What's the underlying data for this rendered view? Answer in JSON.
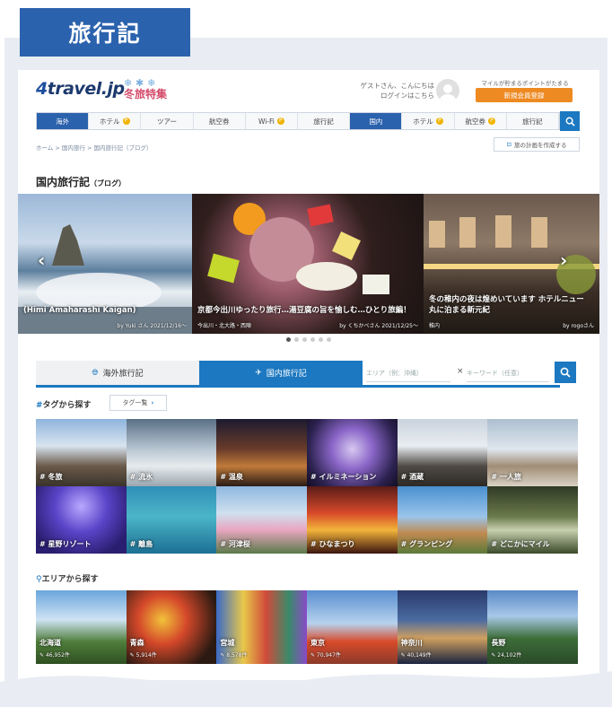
{
  "banner_title": "旅行記",
  "header": {
    "logo_prefix": "4",
    "logo_text": "travel.jp",
    "campaign": "冬旅特集",
    "greeting_line1": "ゲストさん、こんにちは",
    "greeting_line2": "ログインはこちら",
    "mypage_note": "マイルが貯まるポイントがたまる",
    "register_label": "新規会員登録"
  },
  "nav": {
    "items": [
      {
        "label": "海外",
        "active": true,
        "coin": false
      },
      {
        "label": "ホテル",
        "active": false,
        "coin": true
      },
      {
        "label": "ツアー",
        "active": false,
        "coin": false
      },
      {
        "label": "航空券",
        "active": false,
        "coin": false
      },
      {
        "label": "Wi-Fi",
        "active": false,
        "coin": true
      },
      {
        "label": "旅行記",
        "active": false,
        "coin": false
      },
      {
        "label": "国内",
        "active": true,
        "coin": false
      },
      {
        "label": "ホテル",
        "active": false,
        "coin": true
      },
      {
        "label": "航空券",
        "active": false,
        "coin": true
      },
      {
        "label": "旅行記",
        "active": false,
        "coin": false
      }
    ]
  },
  "breadcrumb": "ホーム > 国内旅行 > 国内旅行記（ブログ）",
  "wishlist_label": "旅の計画を作成する",
  "page_title": "国内旅行記",
  "page_title_sub": "（ブログ）",
  "carousel": {
    "slides": [
      {
        "caption": "(Himi Amaharashi Kaigan)",
        "meta": "by Yuki さん 2021/12/16〜",
        "loc": ""
      },
      {
        "caption": "京都今出川ゆったり旅行…湯豆腐の旨を愉しむ…ひとり旅編！",
        "meta": "by くちかべさん 2021/12/25〜",
        "loc": "今出川・北大路・西陣"
      },
      {
        "caption": "冬の稚内の夜は煌めいています ホテルニュー丸に泊まる新元紀",
        "meta": "by rogoさん",
        "loc": "稚内"
      }
    ],
    "dot_count": 6,
    "active_dot": 0
  },
  "tabs": {
    "overseas": "海外旅行記",
    "domestic": "国内旅行記"
  },
  "search": {
    "area_placeholder": "エリア（例：沖縄）",
    "keyword_placeholder": "キーワード（任意）"
  },
  "tag_section": {
    "title": "タグから探す",
    "list_button": "タグ一覧"
  },
  "tags": [
    "冬旅",
    "流氷",
    "温泉",
    "イルミネーション",
    "酒蔵",
    "一人旅",
    "星野リゾート",
    "離島",
    "河津桜",
    "ひなまつり",
    "グランピング",
    "どこかにマイル"
  ],
  "area_section": {
    "title": "エリアから探す"
  },
  "areas": [
    {
      "name": "北海道",
      "count": "46,952件"
    },
    {
      "name": "青森",
      "count": "5,914件"
    },
    {
      "name": "宮城",
      "count": "8,578件"
    },
    {
      "name": "東京",
      "count": "70,947件"
    },
    {
      "name": "神奈川",
      "count": "40,149件"
    },
    {
      "name": "長野",
      "count": "24,102件"
    }
  ],
  "colors": {
    "brand_blue": "#2b62ad",
    "accent_blue": "#1c78c0",
    "orange": "#ee8a22"
  }
}
